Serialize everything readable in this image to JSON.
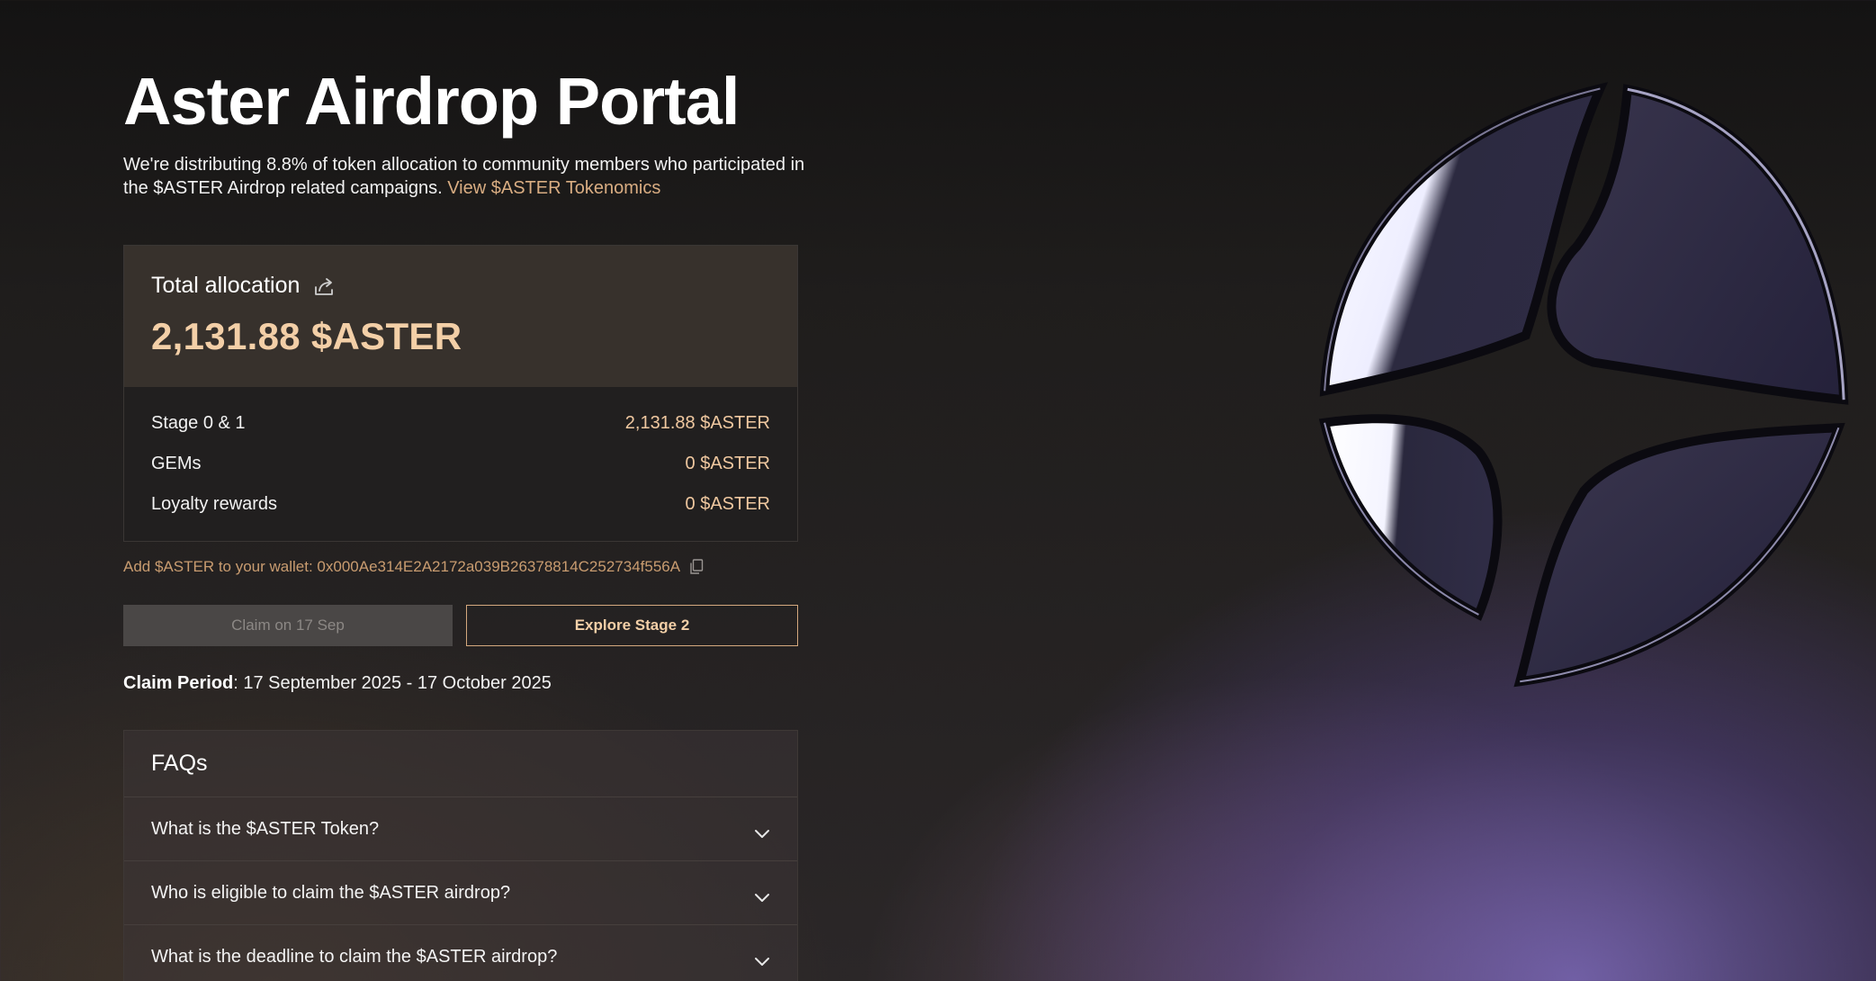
{
  "page": {
    "title": "Aster Airdrop Portal",
    "intro_text": "We're distributing 8.8% of token allocation to community members who participated in the $ASTER Airdrop related campaigns.",
    "intro_link": "View $ASTER Tokenomics"
  },
  "allocation": {
    "label": "Total allocation",
    "total": "2,131.88 $ASTER",
    "rows": [
      {
        "name": "Stage 0 & 1",
        "value": "2,131.88 $ASTER"
      },
      {
        "name": "GEMs",
        "value": "0 $ASTER"
      },
      {
        "name": "Loyalty rewards",
        "value": "0 $ASTER"
      }
    ]
  },
  "wallet": {
    "text": "Add $ASTER to your wallet: 0x000Ae314E2A2172a039B26378814C252734f556A"
  },
  "buttons": {
    "claim": "Claim on 17 Sep",
    "explore": "Explore Stage 2"
  },
  "claim_period": {
    "label": "Claim Period",
    "value": ": 17 September 2025 - 17 October 2025"
  },
  "faq": {
    "title": "FAQs",
    "items": [
      {
        "question": "What is the $ASTER Token?"
      },
      {
        "question": "Who is eligible to claim the $ASTER airdrop?"
      },
      {
        "question": "What is the deadline to claim the $ASTER airdrop?"
      }
    ]
  },
  "colors": {
    "accent": "#f3cfa7",
    "link": "#d9ad82",
    "card_header": "#37312c"
  },
  "icons": {
    "share": "share-icon",
    "copy": "copy-icon",
    "chevron": "chevron-down-icon",
    "logo": "aster-logo"
  }
}
